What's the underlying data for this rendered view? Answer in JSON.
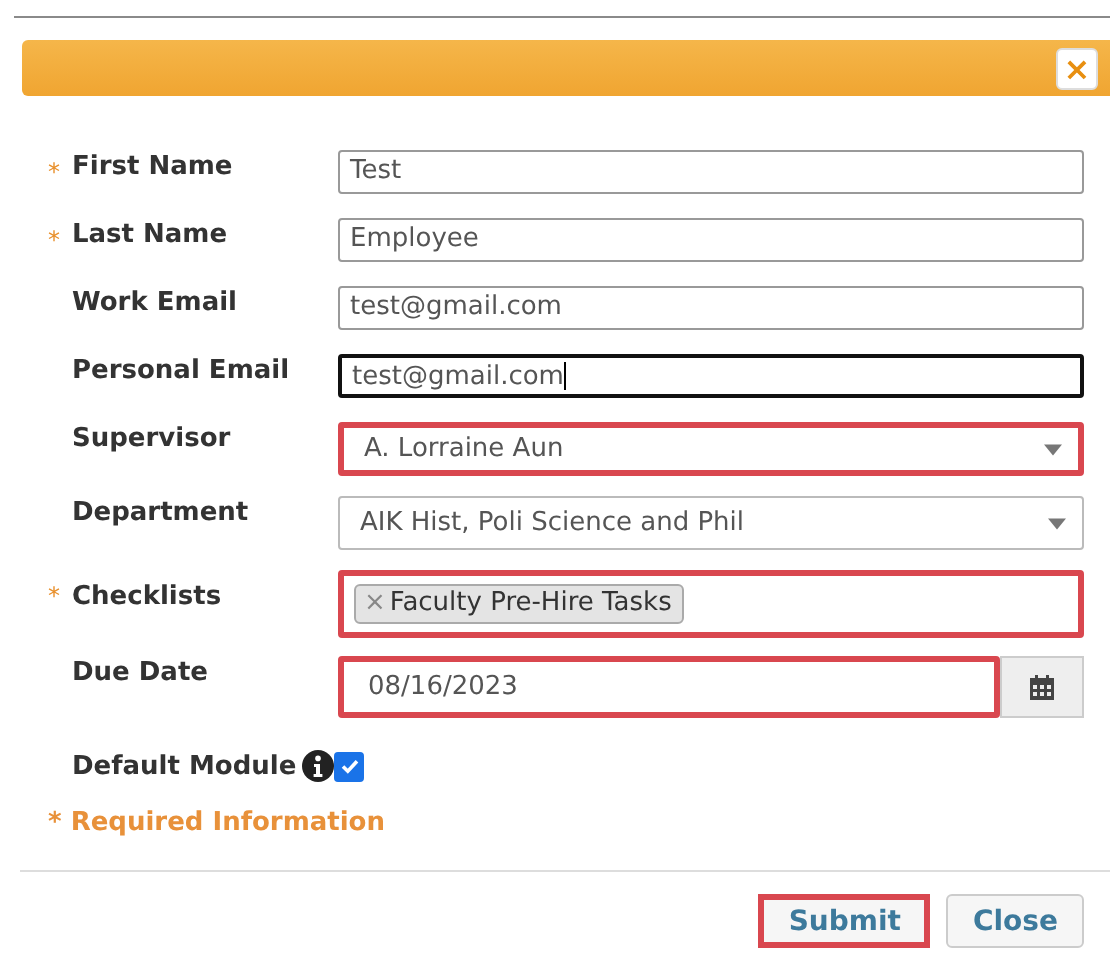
{
  "dialog": {
    "close_icon": "×"
  },
  "required_mark": "*",
  "fields": [
    {
      "kind": "text",
      "label": "First Name",
      "required": true,
      "value": "Test",
      "focused": false
    },
    {
      "kind": "text",
      "label": "Last Name",
      "required": true,
      "value": "Employee",
      "focused": false
    },
    {
      "kind": "text",
      "label": "Work Email",
      "required": false,
      "value": "test@gmail.com",
      "focused": false
    },
    {
      "kind": "text",
      "label": "Personal Email",
      "required": false,
      "value": "test@gmail.com",
      "focused": true
    },
    {
      "kind": "select",
      "label": "Supervisor",
      "required": false,
      "value": "A. Lorraine Aun",
      "highlighted": true
    },
    {
      "kind": "select",
      "label": "Department",
      "required": false,
      "value": "AIK Hist, Poli Science and Phil",
      "highlighted": false
    },
    {
      "kind": "tags",
      "label": "Checklists",
      "required": true,
      "tags": [
        {
          "remove": "×",
          "text": "Faculty Pre-Hire Tasks"
        }
      ],
      "highlighted": true
    },
    {
      "kind": "date",
      "label": "Due Date",
      "required": false,
      "value": "08/16/2023",
      "highlighted": true
    },
    {
      "kind": "checkbox",
      "label": "Default Module",
      "required": false,
      "checked": true
    }
  ],
  "required_note": "* Required Information",
  "buttons": [
    {
      "label": "Submit",
      "highlighted": true
    },
    {
      "label": "Close",
      "highlighted": false
    }
  ]
}
